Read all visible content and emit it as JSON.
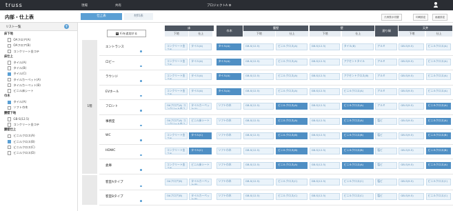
{
  "app": {
    "logo": "truss",
    "nav": [
      "現場",
      "共有"
    ],
    "project": "プロジェクトA ⚙"
  },
  "subbar": {
    "title": "内部・仕上表",
    "tabs": [
      "仕上表",
      "材料表"
    ],
    "right_buttons": [
      "凡例表示切替",
      "印刷設定",
      "画面設定"
    ]
  },
  "sidebar": {
    "header": "リスト一覧",
    "groups": [
      {
        "label": "床下地",
        "items": [
          {
            "t": "OAフロア(A)",
            "on": false
          },
          {
            "t": "OAフロア(B)",
            "on": false
          },
          {
            "t": "コンクリート金コテ",
            "on": false
          }
        ]
      },
      {
        "label": "床仕上",
        "items": [
          {
            "t": "タイル(A)",
            "on": false
          },
          {
            "t": "タイル(B)",
            "on": false
          },
          {
            "t": "タイル(C)",
            "on": true
          },
          {
            "t": "タイルカーペット(A)",
            "on": false
          },
          {
            "t": "タイルカーペット(B)",
            "on": false
          },
          {
            "t": "ビニル床シート",
            "on": false
          }
        ]
      },
      {
        "label": "巾木",
        "items": [
          {
            "t": "タイル(A)",
            "on": true
          },
          {
            "t": "ソフト巾木",
            "on": false
          }
        ]
      },
      {
        "label": "腰壁下地",
        "items": [
          {
            "t": "GB-S(12.5)",
            "on": false
          },
          {
            "t": "コンクリート金コテ",
            "on": false
          }
        ]
      },
      {
        "label": "腰壁仕上",
        "items": [
          {
            "t": "ビニルクロス(A)",
            "on": false
          },
          {
            "t": "ビニルクロス(B)",
            "on": true
          },
          {
            "t": "ビニルクロス(C)",
            "on": false
          },
          {
            "t": "ビニルクロス(D)",
            "on": false
          }
        ]
      }
    ]
  },
  "main": {
    "add_button": "行を追加する",
    "headers": {
      "top": [
        "床",
        "巾木",
        "腰壁",
        "壁",
        "廻り縁",
        "天井"
      ],
      "sub": [
        "下地",
        "仕上",
        "下地",
        "仕上",
        "下地",
        "仕上",
        "下地",
        "仕上"
      ]
    },
    "floor_group": "1階",
    "rows": [
      {
        "name": "エントランス",
        "cells": [
          "コンクリート金コテ",
          "タイル(A)",
          "タイル(A)",
          "GB-S(12.5)",
          "ビニルクロス(A)",
          "GB-S(12.5)",
          "タイル(B)",
          "アルミ",
          "GB-S(9.5)",
          "ビニルクロス(A)"
        ]
      },
      {
        "name": "ロビー",
        "cells": [
          "コンクリート金コテ",
          "タイル(A)",
          "タイル(A)",
          "GB-S(12.5)",
          "ビニルクロス(A)",
          "GB-S(12.5)",
          "アクセントタイル",
          "アルミ",
          "GB-S(9.5)",
          "ビニルクロス(A)"
        ]
      },
      {
        "name": "ラウンジ",
        "cells": [
          "コンクリート金コテ",
          "タイル(A)",
          "タイル(A)",
          "GB-S(12.5)",
          "ビニルクロス(A)",
          "GB-S(12.5)",
          "アクセントクロス(B)",
          "アルミ",
          "GB-S(9.5)",
          "ビニルクロス(A)"
        ]
      },
      {
        "name": "EVホール",
        "cells": [
          "コンクリート金コテ",
          "タイル(A)",
          "タイル(A)",
          "GB-S(12.5)",
          "ビニルクロス(A)",
          "GB-S(12.5)",
          "ビニルクロス(A)",
          "アルミ",
          "GB-S(9.5)",
          "ビニルクロス(A)"
        ]
      },
      {
        "name": "フロント",
        "cells": [
          "OAフロア(A) コンクリート金コテ",
          "タイルカーペット(A)",
          "ソフト巾木",
          "GB-S(12.5)",
          "ビニルクロス(A)",
          "GB-S(12.5)",
          "ビニルクロス(A)",
          "アルミ",
          "GB-S(9.5)",
          "ビニルクロス(A)"
        ]
      },
      {
        "name": "事務室",
        "cells": [
          "OAフロア(A) コンクリート金コテ",
          "ビニル床シート",
          "ソフト巾木",
          "GB-S(12.5)",
          "ビニルクロス(A)",
          "GB-S(12.5)",
          "ビニルクロス(A)",
          "塩ビ",
          "GB-S(9.5)",
          "ビニルクロス(A)"
        ]
      },
      {
        "name": "WC",
        "cells": [
          "コンクリート金コテ",
          "タイル(C)",
          "ソフト巾木",
          "GB-S(12.5)",
          "ビニルクロス(B)",
          "GB-S(12.5)",
          "ビニルクロス(B)",
          "塩ビ",
          "GB-S(9.5)",
          "ビニルクロス(B)"
        ]
      },
      {
        "name": "HDWC",
        "cells": [
          "コンクリート金コテ",
          "タイル(C)",
          "ソフト巾木",
          "GB-S(12.5)",
          "ビニルクロス(B)",
          "GB-S(12.5)",
          "ビニルクロス(B)",
          "塩ビ",
          "GB-S(9.5)",
          "ビニルクロス(B)"
        ]
      },
      {
        "name": "倉庫",
        "cells": [
          "コンクリート金コテ",
          "ビニル床シート",
          "ソフト巾木",
          "GB-S(12.5)",
          "ビニルクロス(A)",
          "GB-S(12.5)",
          "ビニルクロス(A)",
          "塩ビ",
          "GB-S(9.5)",
          "ビニルクロス(A)"
        ]
      }
    ],
    "floor_group2": "",
    "rows2": [
      {
        "name": "客室Aタイプ",
        "cells": [
          "OAフロア(B)",
          "タイルカーペット(B)",
          "ソフト巾木",
          "GB-S(12.5)",
          "ビニルクロス(C)",
          "GB-S(12.5)",
          "ビニルクロス(C)",
          "塩ビ",
          "GB-S(9.5)",
          "ビニルクロス(C)"
        ]
      },
      {
        "name": "客室Bタイプ",
        "cells": [
          "OAフロア(B)",
          "タイルカーペット(B)",
          "ソフト巾木",
          "GB-S(12.5)",
          "ビニルクロス(C)",
          "GB-S(12.5)",
          "ビニルクロス(C)",
          "塩ビ",
          "GB-S(9.5)",
          "ビニルクロス(C)"
        ]
      }
    ]
  },
  "colors": {
    "topbar": "#2a2d33",
    "accent": "#5a9fd4",
    "header": "#4d5560",
    "cell_light": "#eaf3fa",
    "cell_dark": "#4f8fc4"
  }
}
